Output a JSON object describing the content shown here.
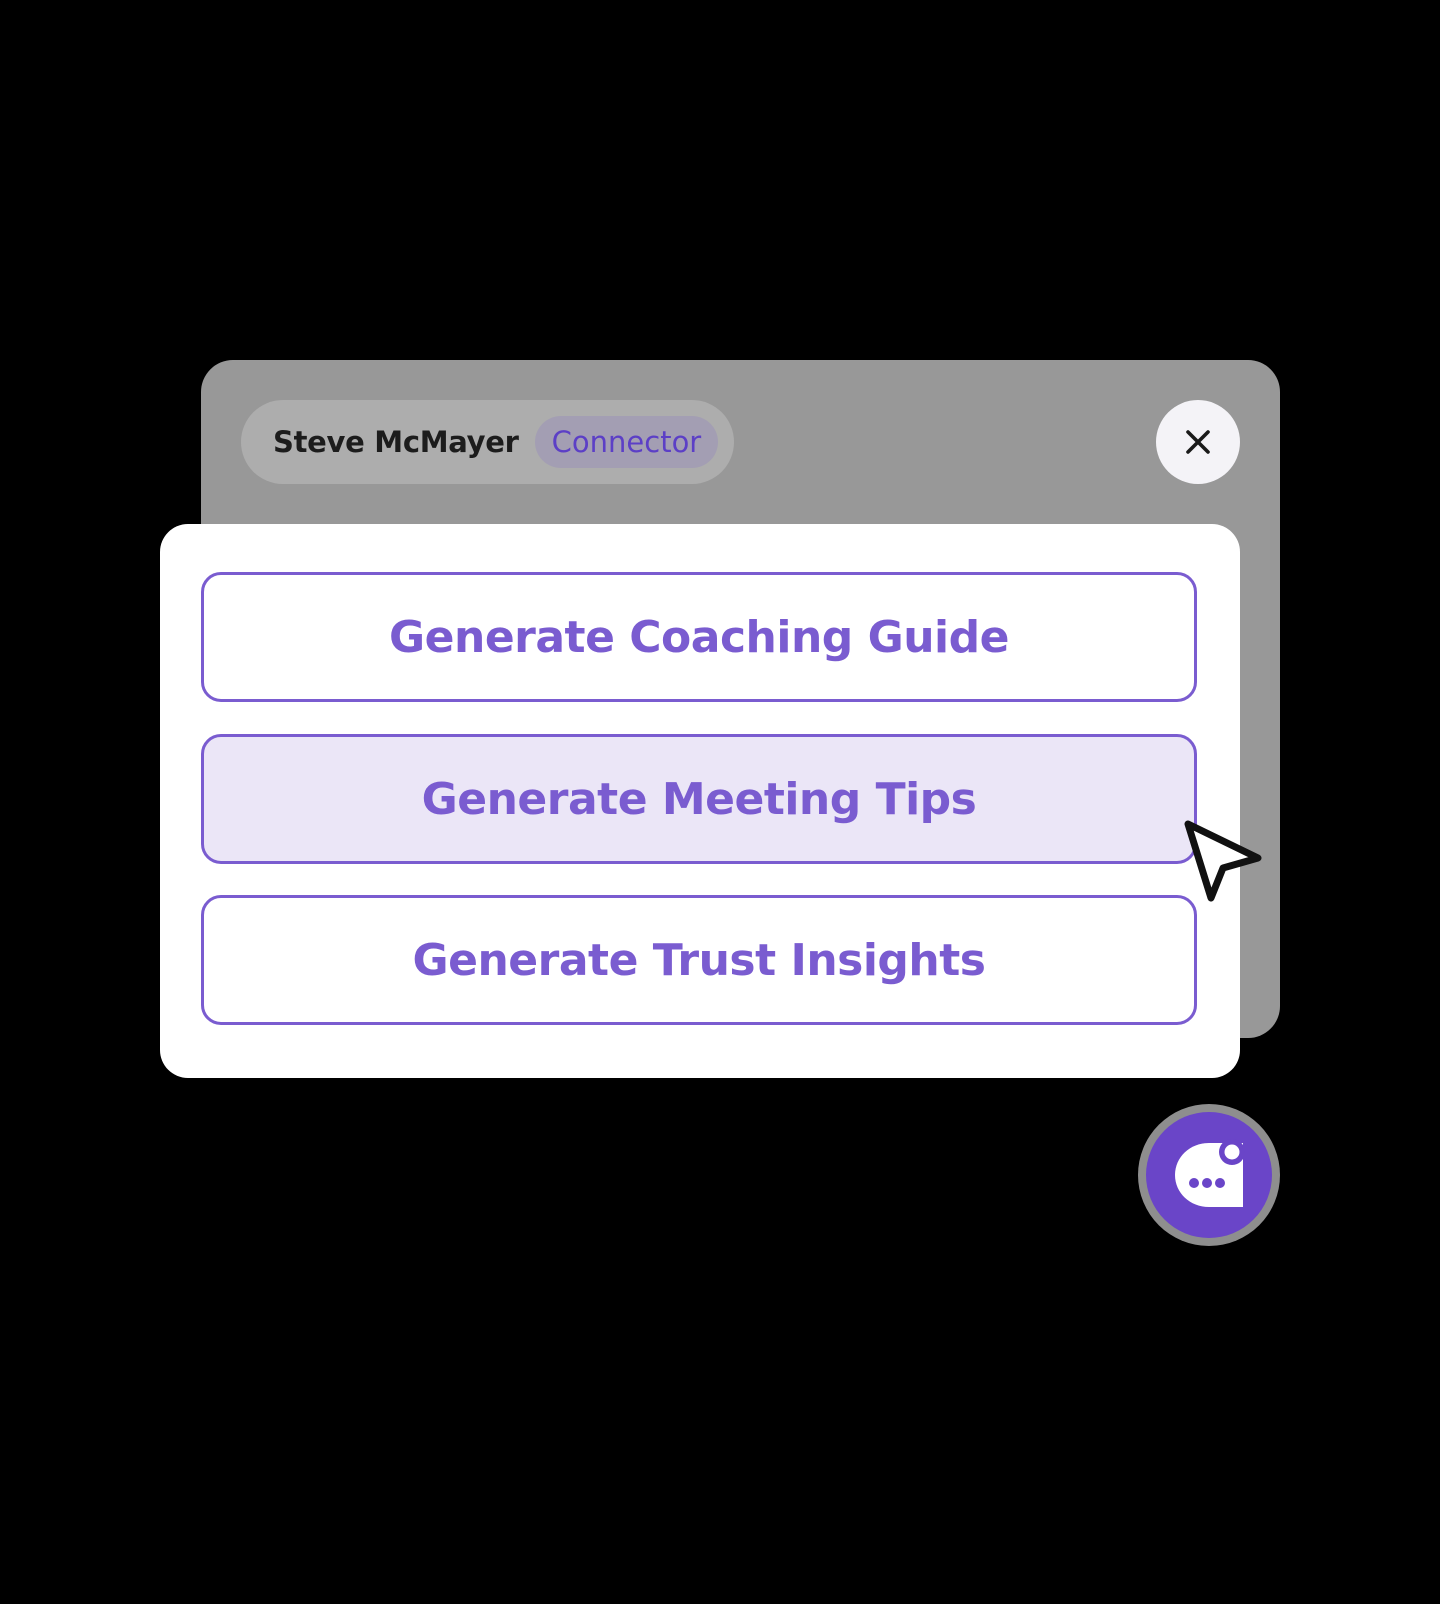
{
  "header": {
    "user_name": "Steve McMayer",
    "role_badge": "Connector"
  },
  "actions": [
    {
      "label": "Generate Coaching Guide",
      "state": "default"
    },
    {
      "label": "Generate Meeting Tips",
      "state": "hovered"
    },
    {
      "label": "Generate Trust Insights",
      "state": "default"
    }
  ],
  "icons": {
    "close": "close-icon",
    "cursor": "mouse-pointer-icon",
    "chat": "chat-bubble-icon"
  },
  "colors": {
    "accent": "#7a5cd0",
    "accent_dark": "#6a45c8",
    "hover_fill": "#ebe6f7",
    "back_panel": "#989898",
    "background": "#000000"
  }
}
